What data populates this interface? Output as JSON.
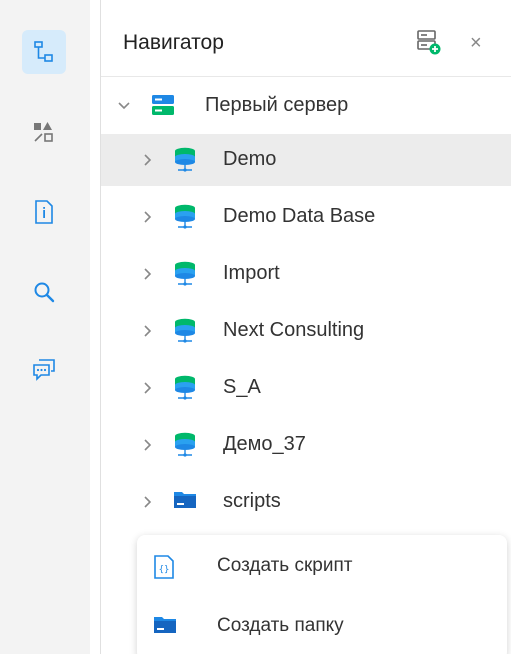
{
  "navigator": {
    "title": "Навигатор",
    "close_label": "×",
    "server": {
      "label": "Первый сервер"
    },
    "items": [
      {
        "label": "Demo",
        "type": "database"
      },
      {
        "label": "Demo Data Base",
        "type": "database"
      },
      {
        "label": "Import",
        "type": "database"
      },
      {
        "label": "Next Consulting",
        "type": "database"
      },
      {
        "label": "S_A",
        "type": "database"
      },
      {
        "label": "Демо_37",
        "type": "database"
      },
      {
        "label": "scripts",
        "type": "folder"
      }
    ]
  },
  "context_menu": {
    "items": [
      {
        "label": "Создать скрипт",
        "icon": "script-file-icon"
      },
      {
        "label": "Создать папку",
        "icon": "folder-icon"
      }
    ]
  },
  "activity_bar": {
    "buttons": [
      "navigator-icon",
      "shapes-icon",
      "info-document-icon",
      "search-icon",
      "chat-icon"
    ]
  },
  "colors": {
    "accent": "#00b86b",
    "icon_blue": "#1e88e5",
    "active_bg": "#d6ebfb"
  }
}
